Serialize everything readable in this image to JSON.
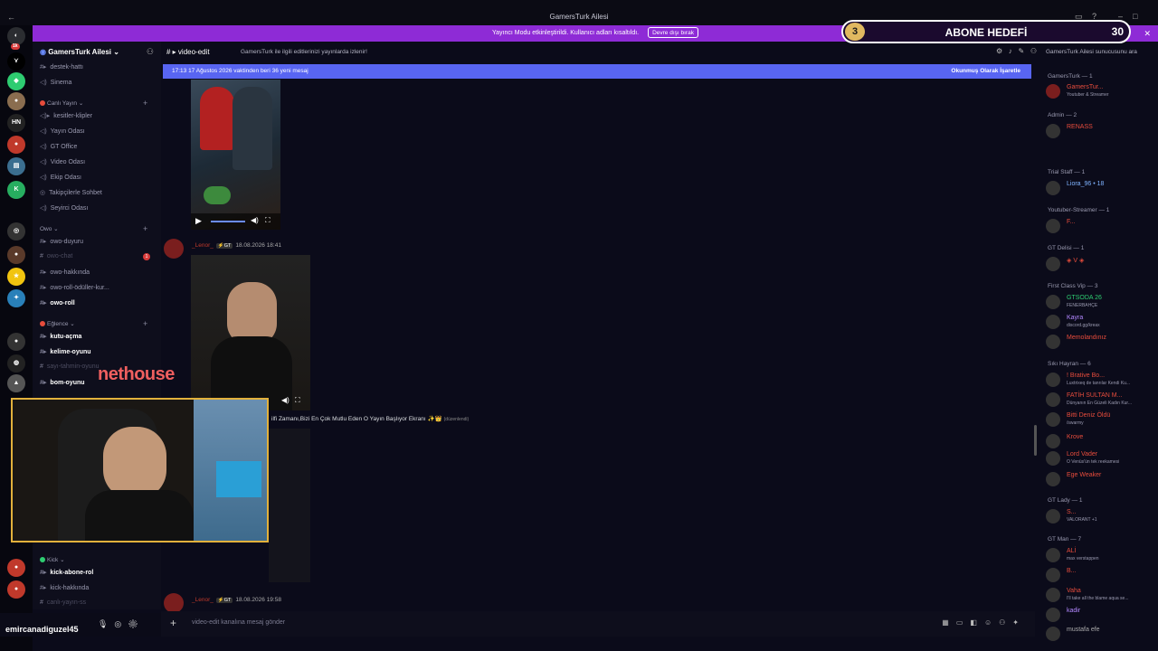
{
  "window": {
    "title": "GamersTurk Ailesi",
    "back": "←"
  },
  "banner": {
    "text": "Yayıncı Modu etkinleştirildi. Kullanıcı adları kısaltıldı.",
    "button": "Devre dışı bırak",
    "close": "✕"
  },
  "goal": {
    "start": "3",
    "label": "ABONE HEDEFİ",
    "end": "30"
  },
  "server": {
    "name": "GamersTurk Ailesi",
    "chev": "⌄"
  },
  "channels": [
    {
      "label": "destek-hattı",
      "y": 0
    },
    {
      "label": "Sinema"
    },
    {
      "label": "kesitler-klipler"
    },
    {
      "label": "Yayın Odası"
    },
    {
      "label": "GT Office"
    },
    {
      "label": "Video Odası"
    },
    {
      "label": "Ekip Odası"
    },
    {
      "label": "Takipçilerle Sohbet"
    },
    {
      "label": "Seyirci Odası"
    },
    {
      "label": "owo-duyuru"
    },
    {
      "label": "owo-chat",
      "badge": "1"
    },
    {
      "label": "owo-hakkında"
    },
    {
      "label": "owo-roll-ödüller-kur..."
    },
    {
      "label": "owo-roll"
    },
    {
      "label": "kutu-açma"
    },
    {
      "label": "kelime-oyunu"
    },
    {
      "label": "sayı-tahmin-oyunu"
    },
    {
      "label": "bom-oyunu"
    },
    {
      "label": "kick-abone-rol"
    },
    {
      "label": "kick-hakkında"
    },
    {
      "label": "canlı-yayın-ss"
    }
  ],
  "categories": [
    "Canlı Yayın",
    "Owo",
    "Eğlence",
    "Kick"
  ],
  "header": {
    "channel": "video-edit",
    "topic": "GamersTurk ile ilgili editlerinizi yayınlarda izlenir!"
  },
  "search": {
    "placeholder": "GamersTurk Ailesi sunucusunu ara"
  },
  "newmsg": {
    "text": "17:13 17 Ağustos 2026 vaktinden beri 36 yeni mesaj",
    "mark": "Okunmuş Olarak İşaretle"
  },
  "messages": [
    {
      "user": "_Lenor_",
      "tag": "⚡GT",
      "time": "18.08.2026 18:41"
    },
    {
      "user": "_Lenor_",
      "tag": "⚡GT",
      "time": "18.08.2026 19:58"
    }
  ],
  "message_text": {
    "text": "ilfi Zamanı,Bizi En Çok Mutlu Eden O Yayın Başlıyor Ekranı ✨👑",
    "edited": "(düzenlendi)"
  },
  "overlay": "nethouse",
  "input": {
    "placeholder": "video-edit kanalına mesaj gönder"
  },
  "user": {
    "name": "emircanadiguzel45"
  },
  "member_roles": [
    {
      "label": "GamersTurk — 1"
    },
    {
      "label": "Admin — 2"
    },
    {
      "label": "Trial Staff — 1"
    },
    {
      "label": "Youtuber-Streamer — 1"
    },
    {
      "label": "GT Delisi — 1"
    },
    {
      "label": "First Class Vip — 3"
    },
    {
      "label": "Sıkı Hayran — 6"
    },
    {
      "label": "GT Lady — 1"
    },
    {
      "label": "GT Man — 7"
    }
  ],
  "members": [
    {
      "name": "GamersTur...",
      "sub": "Youtuber & Streamer",
      "color": "#e74c3c"
    },
    {
      "name": "RENASS",
      "sub": "",
      "color": "#e74c3c"
    },
    {
      "name": "Liora_96 • 18",
      "sub": "",
      "color": "#7fb3ff"
    },
    {
      "name": "F...",
      "sub": "",
      "color": "#e74c3c"
    },
    {
      "name": "◈ V ◈",
      "sub": "",
      "color": "#e74c3c"
    },
    {
      "name": "GTSODA 26",
      "sub": "FENERBAHÇE",
      "color": "#2ecc71"
    },
    {
      "name": "Kayra",
      "sub": "discord.gg/kreax",
      "color": "#b388ff"
    },
    {
      "name": "Memolandınız",
      "sub": "",
      "color": "#e74c3c"
    },
    {
      "name": "! Brative Bo...",
      "sub": "Luxtrixeq de tanrılar Kendi Ku...",
      "color": "#e74c3c"
    },
    {
      "name": "FATİH SULTAN M...",
      "sub": "Dünyanın En Güzeli Kadın Kur...",
      "color": "#e74c3c"
    },
    {
      "name": "Bitti Deniz Öldü",
      "sub": "/swarmy",
      "color": "#e74c3c"
    },
    {
      "name": "Krove",
      "sub": "",
      "color": "#e74c3c"
    },
    {
      "name": "Lord Vader",
      "sub": "O Venüs'ün tek reekamesi",
      "color": "#e74c3c"
    },
    {
      "name": "Ege Weaker",
      "sub": "",
      "color": "#e74c3c"
    },
    {
      "name": "S...",
      "sub": "VALORANT +1",
      "color": "#e74c3c"
    },
    {
      "name": "ALİ",
      "sub": "max verstappen",
      "color": "#e74c3c"
    },
    {
      "name": "B...",
      "sub": "",
      "color": "#e74c3c"
    },
    {
      "name": "Vaha",
      "sub": "I'll take all the blame aqua se...",
      "color": "#e74c3c"
    },
    {
      "name": "kadir",
      "sub": "",
      "color": "#b388ff"
    },
    {
      "name": "mustafa efe",
      "sub": "",
      "color": "#aaa"
    }
  ]
}
